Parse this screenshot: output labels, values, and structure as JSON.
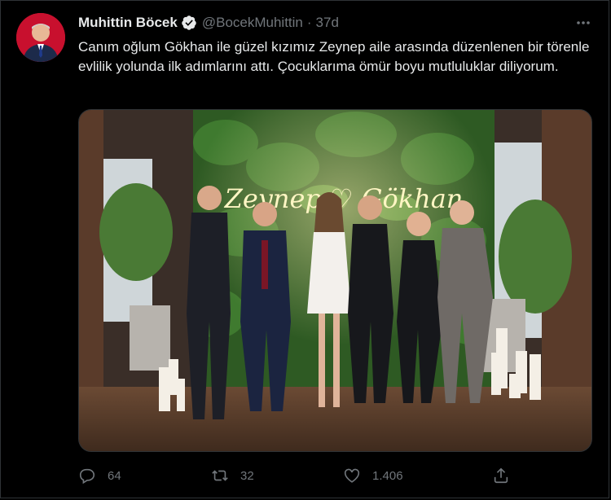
{
  "tweet": {
    "author_name": "Muhittin Böcek",
    "author_handle": "@BocekMuhittin",
    "separator": "·",
    "time": "37d",
    "text": "Canım oğlum Gökhan ile güzel kızımız Zeynep aile arasında düzenlenen bir törenle evlilik yolunda ilk adımlarını attı. Çocuklarıma ömür boyu mutluluklar diliyorum.",
    "neon_sign_text": "Zeynep ♡ Gökhan"
  },
  "actions": {
    "replies": "64",
    "retweets": "32",
    "likes": "1.406"
  },
  "colors": {
    "background": "#000000",
    "text_primary": "#e7e9ea",
    "text_secondary": "#71767b",
    "border": "#2f3336",
    "verified_badge": "#e7e9ea"
  },
  "icons": [
    "verified-badge-icon",
    "more-options-icon",
    "reply-icon",
    "retweet-icon",
    "like-icon",
    "share-icon"
  ]
}
